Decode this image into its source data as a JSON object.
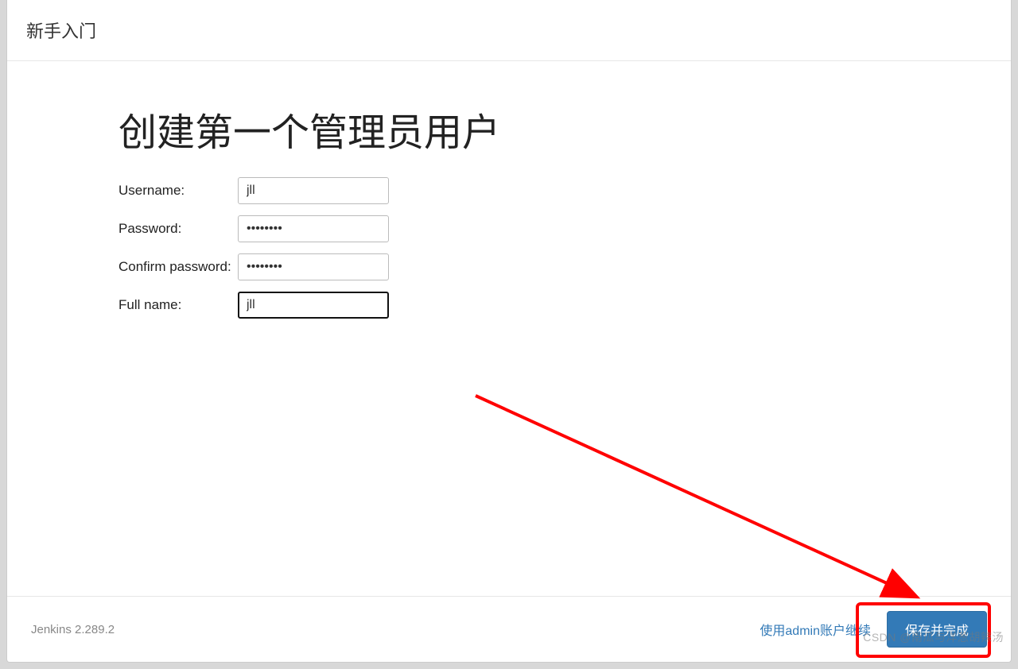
{
  "header": {
    "title": "新手入门"
  },
  "main": {
    "title": "创建第一个管理员用户",
    "fields": {
      "username": {
        "label": "Username:",
        "value": "jll"
      },
      "password": {
        "label": "Password:",
        "value": "••••••••"
      },
      "confirm": {
        "label": "Confirm password:",
        "value": "••••••••"
      },
      "fullname": {
        "label": "Full name:",
        "value": "jll"
      }
    }
  },
  "footer": {
    "version": "Jenkins 2.289.2",
    "skip_link": "使用admin账户继续",
    "submit": "保存并完成"
  },
  "watermark": "CSDN @南瓜与洋葱胡辣汤"
}
